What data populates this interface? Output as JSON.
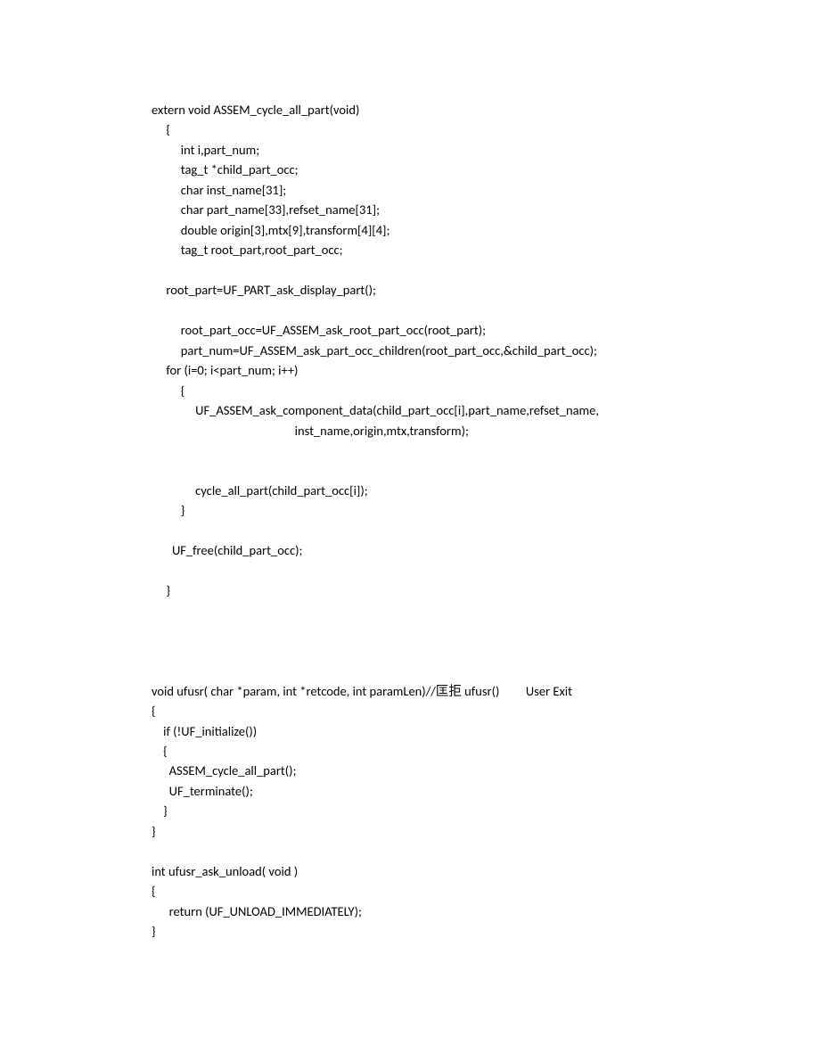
{
  "lines": [
    "extern void ASSEM_cycle_all_part(void)",
    "     {",
    "          int i,part_num;",
    "          tag_t *child_part_occ;",
    "          char inst_name[31];",
    "          char part_name[33],refset_name[31];",
    "          double origin[3],mtx[9],transform[4][4];",
    "          tag_t root_part,root_part_occ;",
    "",
    "     root_part=UF_PART_ask_display_part();",
    "",
    "          root_part_occ=UF_ASSEM_ask_root_part_occ(root_part);",
    "          part_num=UF_ASSEM_ask_part_occ_children(root_part_occ,&child_part_occ);",
    "     for (i=0; i<part_num; i++)",
    "          {",
    "               UF_ASSEM_ask_component_data(child_part_occ[i],part_name,refset_name,",
    "                                                 inst_name,origin,mtx,transform);",
    "",
    "",
    "               cycle_all_part(child_part_occ[i]);",
    "          }",
    "",
    "       UF_free(child_part_occ);",
    "",
    "     }",
    "",
    "",
    "",
    "",
    "void ufusr( char *param, int *retcode, int paramLen)//匡拒 ufusr()         User Exit",
    "{",
    "    if (!UF_initialize())",
    "    {",
    "      ASSEM_cycle_all_part();",
    "      UF_terminate();",
    "    }",
    "}",
    "",
    "int ufusr_ask_unload( void )",
    "{",
    "      return (UF_UNLOAD_IMMEDIATELY);",
    "}"
  ]
}
